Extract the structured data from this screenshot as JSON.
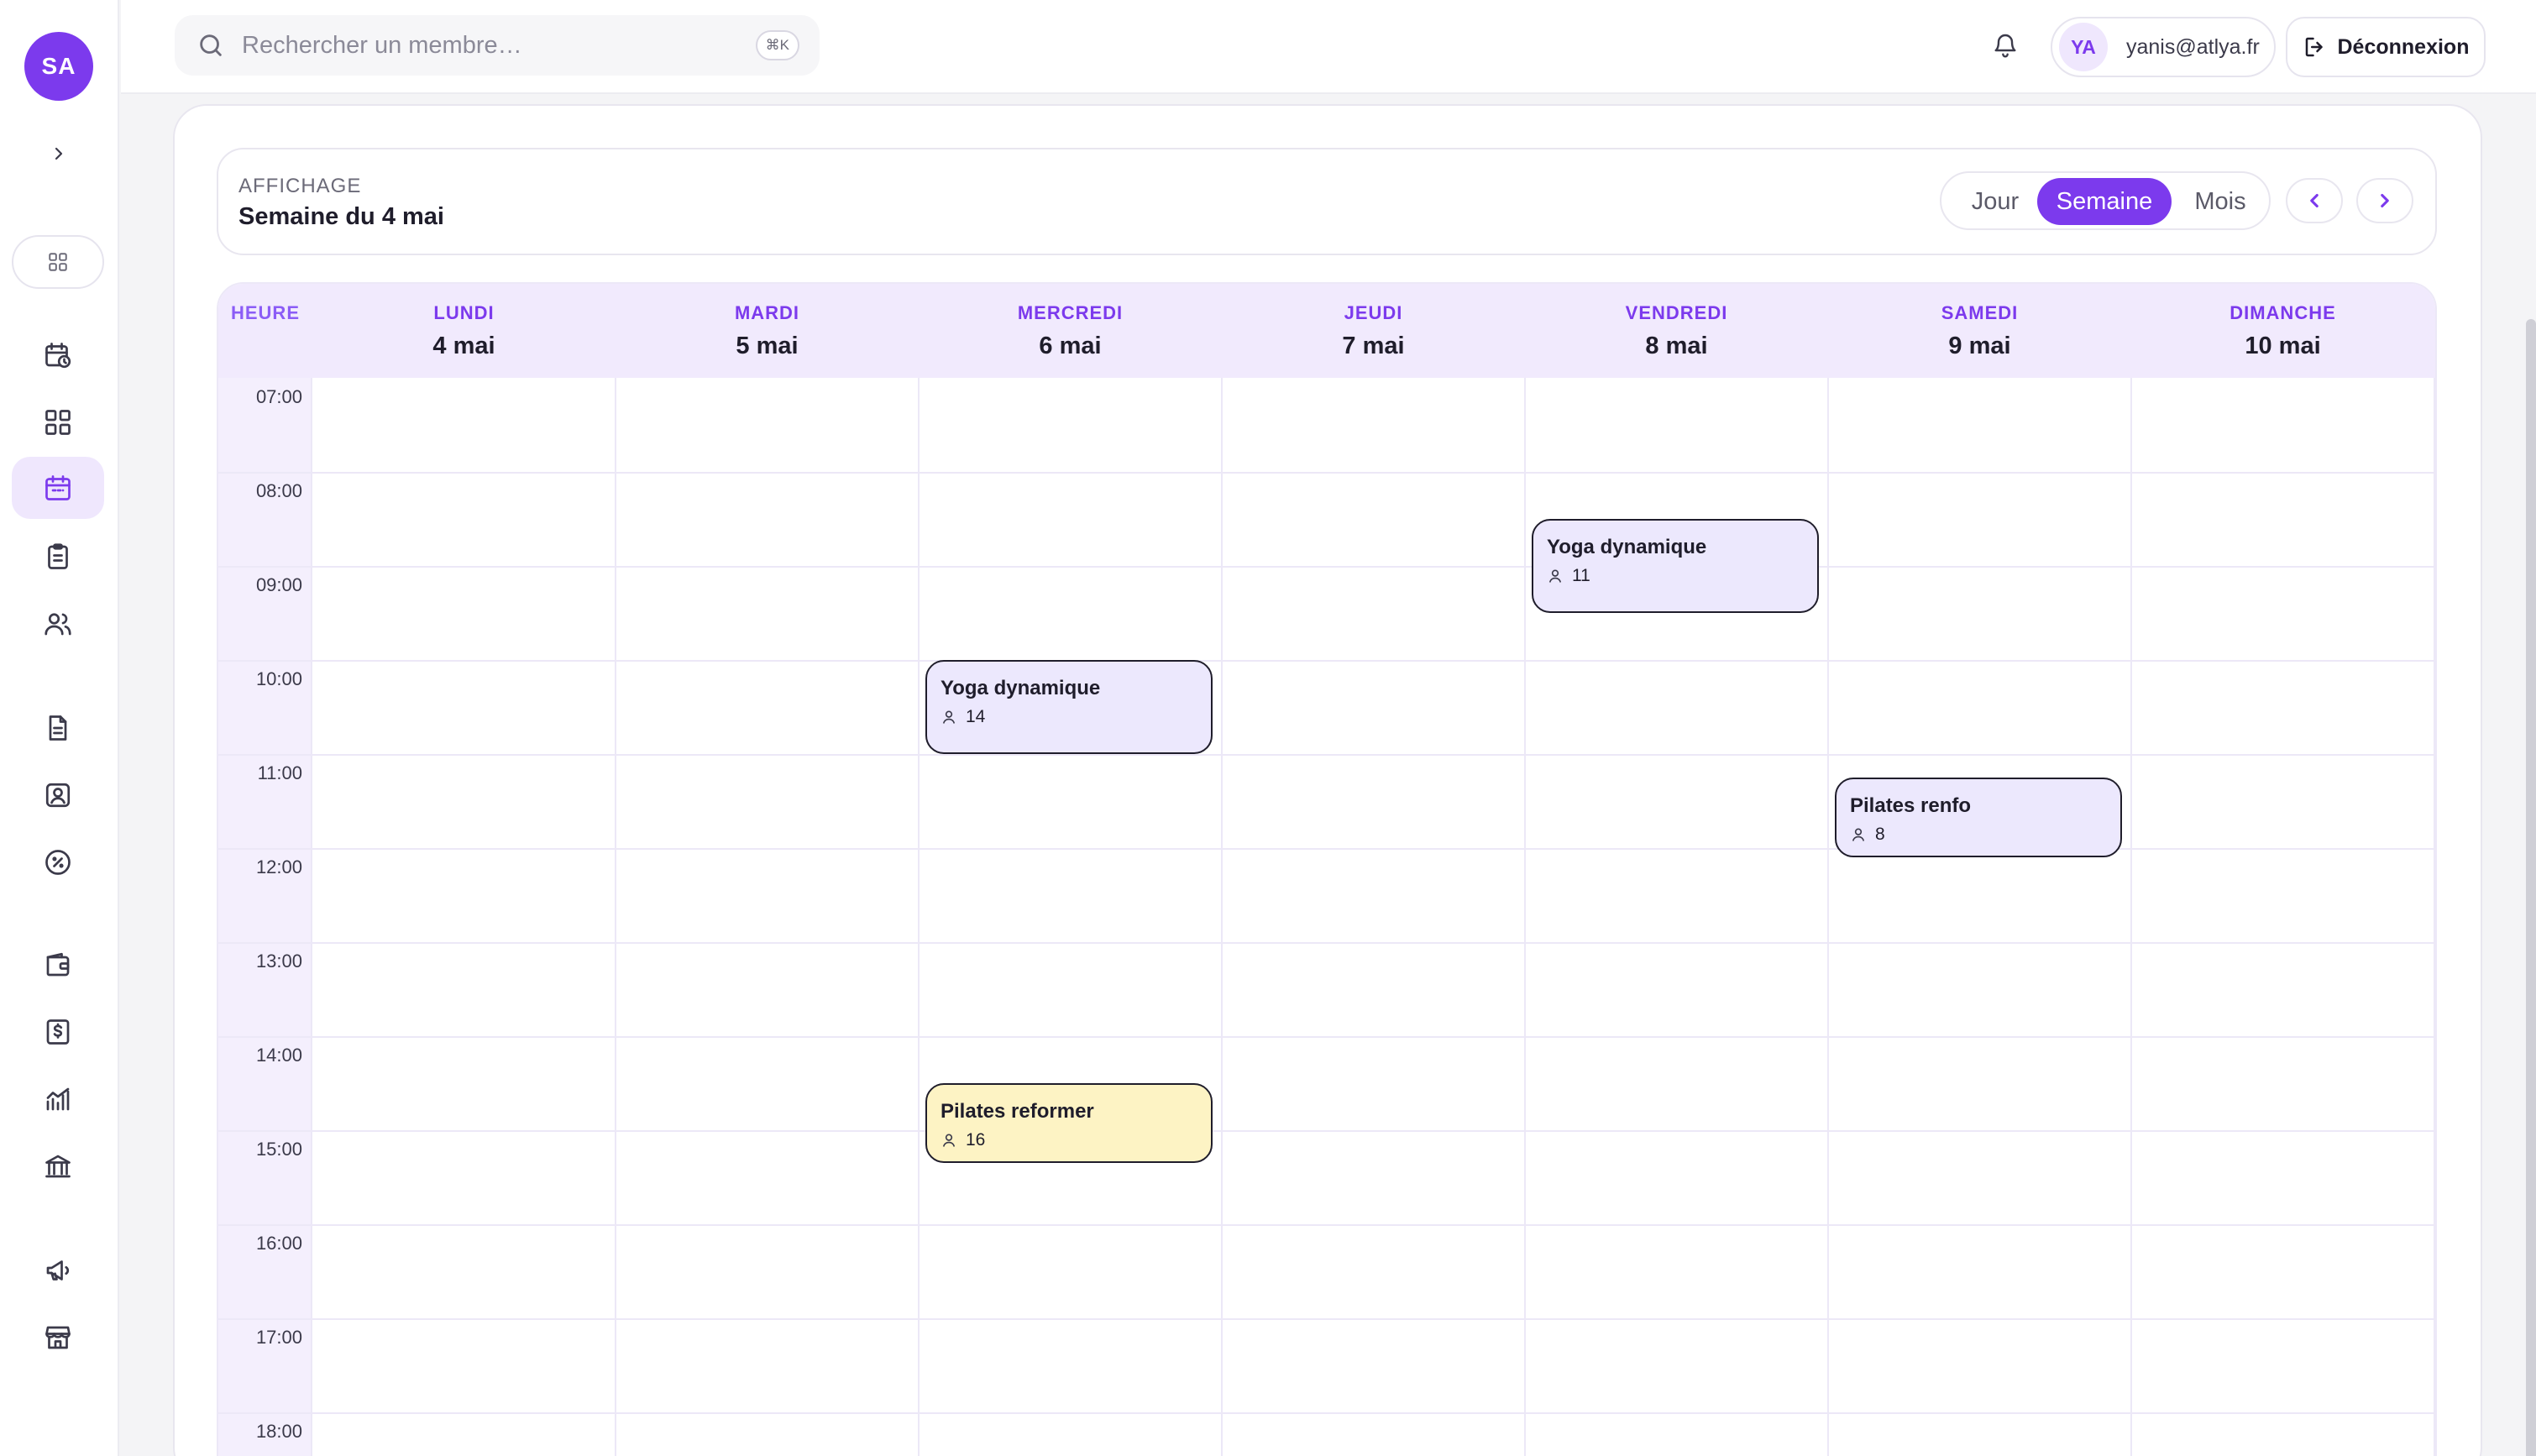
{
  "sidebar": {
    "avatar_initials": "SA",
    "items": [
      {
        "name": "calendar-clock-icon"
      },
      {
        "name": "dashboard-icon"
      },
      {
        "name": "calendar-icon",
        "active": true
      },
      {
        "name": "clipboard-icon"
      },
      {
        "name": "users-icon"
      },
      {
        "name": "document-icon"
      },
      {
        "name": "contact-card-icon"
      },
      {
        "name": "discount-icon"
      },
      {
        "name": "wallet-icon"
      },
      {
        "name": "dollar-invoice-icon"
      },
      {
        "name": "analytics-chart-icon"
      },
      {
        "name": "bank-icon"
      },
      {
        "name": "megaphone-icon"
      },
      {
        "name": "store-icon"
      }
    ]
  },
  "topbar": {
    "search_placeholder": "Rechercher un membre…",
    "search_shortcut": "⌘K",
    "user_initials": "YA",
    "user_email": "yanis@atlya.fr",
    "logout_label": "Déconnexion"
  },
  "view": {
    "label": "AFFICHAGE",
    "title": "Semaine du 4 mai",
    "modes": [
      "Jour",
      "Semaine",
      "Mois"
    ],
    "active_mode": "Semaine"
  },
  "calendar": {
    "hour_header": "HEURE",
    "days": [
      {
        "name": "LUNDI",
        "date": "4 mai"
      },
      {
        "name": "MARDI",
        "date": "5 mai"
      },
      {
        "name": "MERCREDI",
        "date": "6 mai"
      },
      {
        "name": "JEUDI",
        "date": "7 mai"
      },
      {
        "name": "VENDREDI",
        "date": "8 mai"
      },
      {
        "name": "SAMEDI",
        "date": "9 mai"
      },
      {
        "name": "DIMANCHE",
        "date": "10 mai"
      }
    ],
    "hours": [
      "07:00",
      "08:00",
      "09:00",
      "10:00",
      "11:00",
      "12:00",
      "13:00",
      "14:00",
      "15:00",
      "16:00",
      "17:00",
      "18:00"
    ],
    "events": [
      {
        "title": "Yoga dynamique",
        "count": "11",
        "day": 4,
        "start": 8.5,
        "end": 9.5,
        "color": "#ece8fd"
      },
      {
        "title": "Yoga dynamique",
        "count": "14",
        "day": 2,
        "start": 10.0,
        "end": 11.0,
        "color": "#ece8fd"
      },
      {
        "title": "Pilates renfo",
        "count": "8",
        "day": 5,
        "start": 11.25,
        "end": 12.1,
        "color": "#ece8fd"
      },
      {
        "title": "Pilates reformer",
        "count": "16",
        "day": 2,
        "start": 14.5,
        "end": 15.35,
        "color": "#fdf3c4"
      }
    ]
  },
  "colors": {
    "accent": "#7c3aed",
    "event_default": "#ece8fd",
    "event_yellow": "#fdf3c4"
  }
}
